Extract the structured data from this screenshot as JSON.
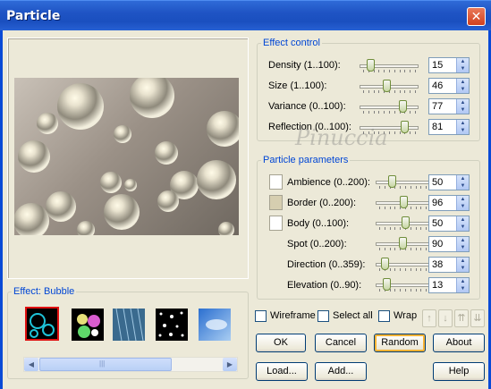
{
  "window": {
    "title": "Particle",
    "close_glyph": "✕"
  },
  "effect_control": {
    "legend": "Effect control",
    "rows": [
      {
        "label": "Density (1..100):",
        "value": "15",
        "level": 0.14
      },
      {
        "label": "Size (1..100):",
        "value": "46",
        "level": 0.45
      },
      {
        "label": "Variance (0..100):",
        "value": "77",
        "level": 0.77
      },
      {
        "label": "Reflection (0..100):",
        "value": "81",
        "level": 0.81
      }
    ]
  },
  "particle_parameters": {
    "legend": "Particle parameters",
    "rows": [
      {
        "label": "Ambience (0..200):",
        "value": "50",
        "level": 0.25,
        "swatch": "#ffffff"
      },
      {
        "label": "Border (0..200):",
        "value": "96",
        "level": 0.48,
        "swatch": "#d6ceb0"
      },
      {
        "label": "Body (0..100):",
        "value": "50",
        "level": 0.5,
        "swatch": "#ffffff"
      },
      {
        "label": "Spot (0..200):",
        "value": "90",
        "level": 0.45
      },
      {
        "label": "Direction (0..359):",
        "value": "38",
        "level": 0.11
      },
      {
        "label": "Elevation (0..90):",
        "value": "13",
        "level": 0.14
      }
    ]
  },
  "effect_group": {
    "legend": "Effect: Bubble"
  },
  "checkboxes": {
    "wireframe": "Wireframe",
    "select_all": "Select all",
    "wrap": "Wrap"
  },
  "buttons": {
    "ok": "OK",
    "cancel": "Cancel",
    "random": "Random",
    "about": "About",
    "load": "Load...",
    "add": "Add...",
    "help": "Help"
  },
  "move_arrows": [
    "↑",
    "↓",
    "⇈",
    "⇊"
  ],
  "scroll_arrows": {
    "left": "◀",
    "right": "▶",
    "grip": "|||"
  },
  "watermark": "Pinuccia",
  "colors": {
    "title_bar": "#1f54c4",
    "legend": "#0046d5",
    "selected_tile": "#e01010"
  }
}
